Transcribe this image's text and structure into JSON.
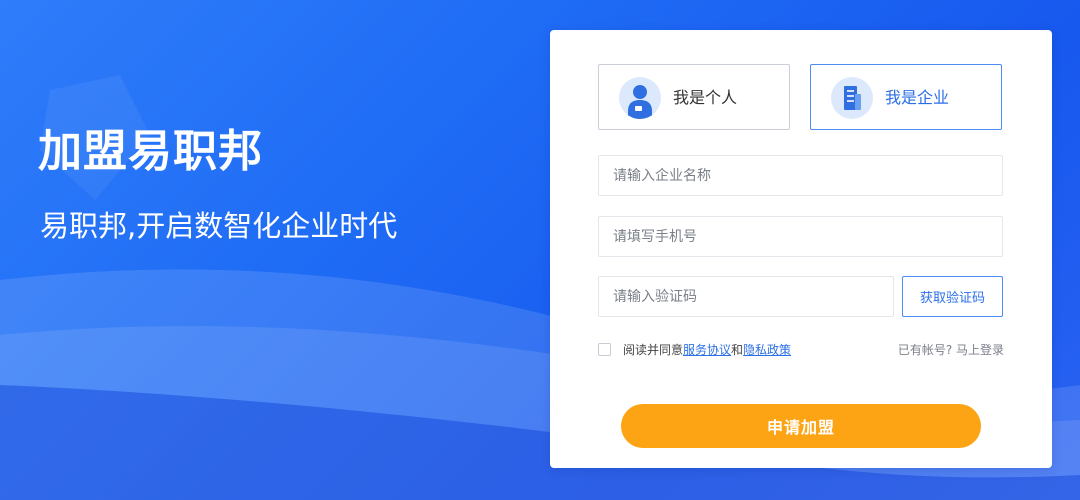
{
  "hero": {
    "title": "加盟易职邦",
    "subtitle": "易职邦,开启数智化企业时代"
  },
  "form": {
    "types": [
      {
        "label": "我是个人",
        "icon": "person-icon",
        "selected": false
      },
      {
        "label": "我是企业",
        "icon": "building-icon",
        "selected": true
      }
    ],
    "company_name": {
      "value": "",
      "placeholder": "请输入企业名称"
    },
    "phone": {
      "value": "",
      "placeholder": "请填写手机号"
    },
    "verification_code": {
      "value": "",
      "placeholder": "请输入验证码"
    },
    "get_code_label": "获取验证码",
    "agreement": {
      "checked": false,
      "prefix": "阅读并同意",
      "service_link": "服务协议",
      "joiner": "和",
      "privacy_link": "隐私政策"
    },
    "login_prompt": "已有帐号? 马上登录",
    "submit_label": "申请加盟"
  },
  "colors": {
    "brand_blue": "#1f6cf5",
    "accent_blue": "#2b6fe6",
    "submit_orange": "#fca413"
  }
}
